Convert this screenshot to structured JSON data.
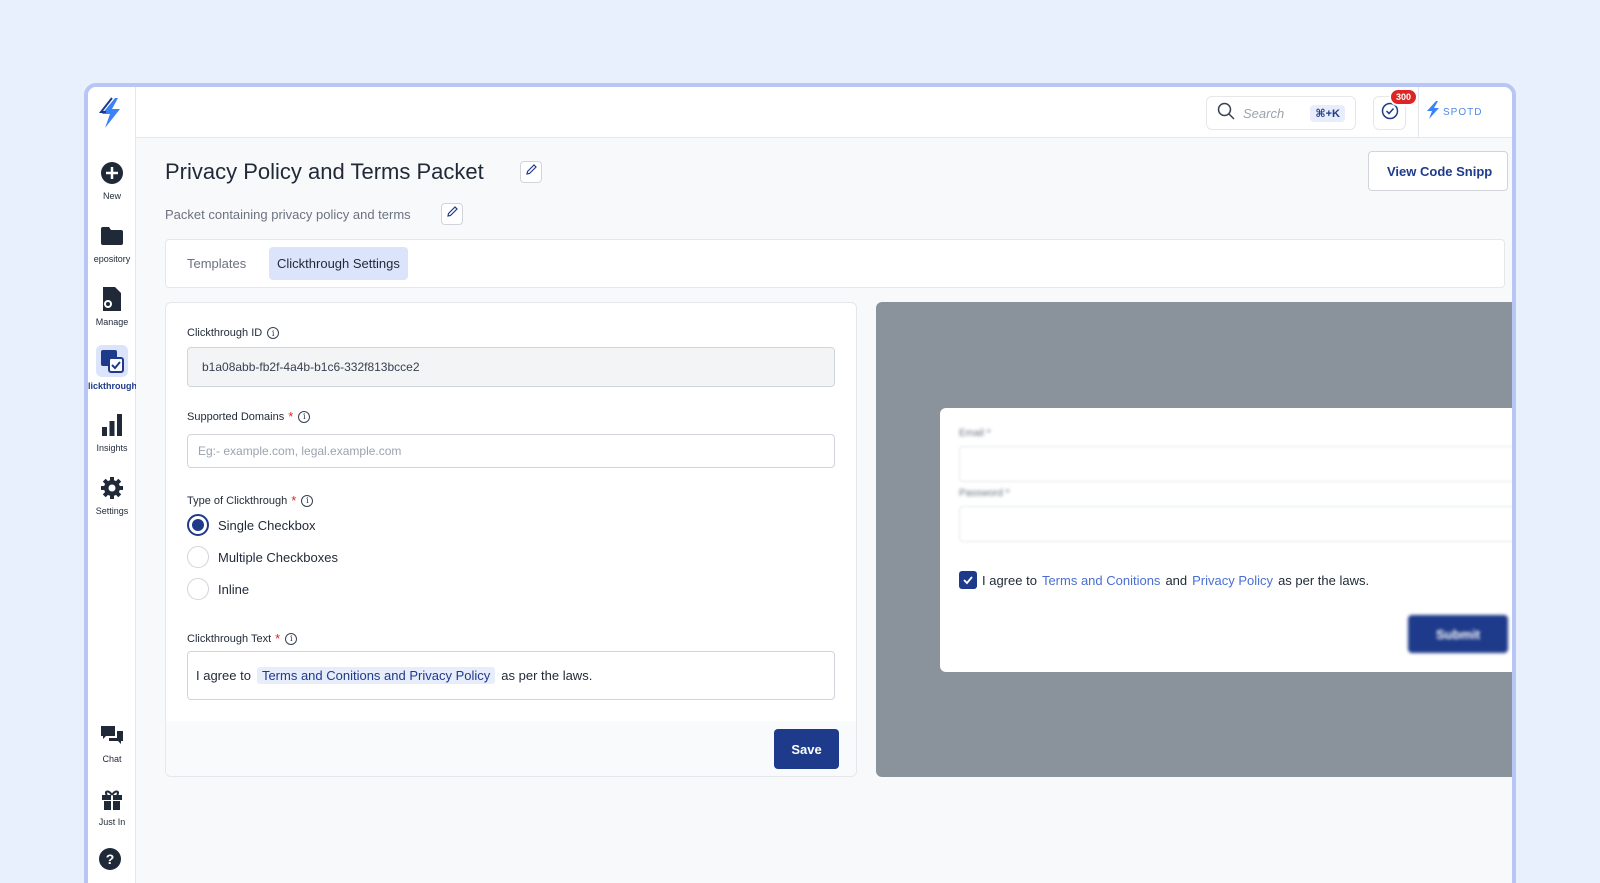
{
  "sidebar": {
    "items": [
      {
        "label": "New",
        "icon": "plus-circle-icon"
      },
      {
        "label": "epository",
        "icon": "folder-icon"
      },
      {
        "label": "Manage",
        "icon": "manage-document-icon"
      },
      {
        "label": "lickthrough",
        "icon": "clickthrough-icon",
        "active": true
      },
      {
        "label": "Insights",
        "icon": "bar-chart-icon"
      },
      {
        "label": "Settings",
        "icon": "gear-icon"
      }
    ],
    "bottom_items": [
      {
        "label": "Chat",
        "icon": "chat-icon"
      },
      {
        "label": "Just In",
        "icon": "gift-icon"
      },
      {
        "label": "",
        "icon": "help-icon"
      }
    ]
  },
  "topbar": {
    "search_placeholder": "Search",
    "search_shortcut": "⌘+K",
    "notification_count": "300",
    "brand": "SPOTD"
  },
  "header": {
    "title": "Privacy Policy and Terms Packet",
    "subtitle": "Packet containing privacy policy and terms",
    "view_code_label": "View Code Snipp"
  },
  "tabs": [
    {
      "label": "Templates"
    },
    {
      "label": "Clickthrough Settings",
      "active": true
    }
  ],
  "form": {
    "id_label": "Clickthrough ID",
    "id_value": "b1a08abb-fb2f-4a4b-b1c6-332f813bcce2",
    "domains_label": "Supported Domains",
    "domains_placeholder": "Eg:- example.com, legal.example.com",
    "type_label": "Type of Clickthrough",
    "type_options": [
      "Single Checkbox",
      "Multiple Checkboxes",
      "Inline"
    ],
    "type_selected": "Single Checkbox",
    "text_label": "Clickthrough Text",
    "text_prefix": "I agree to",
    "text_chip": "Terms and Conitions and Privacy Policy",
    "text_suffix": "as per the laws.",
    "save_label": "Save",
    "required_mark": "*",
    "info_glyph": "i"
  },
  "preview": {
    "email_label": "Email *",
    "password_label": "Password *",
    "agree_prefix": "I agree to",
    "link1": "Terms and Conitions",
    "agree_and": "and",
    "link2": "Privacy Policy",
    "agree_suffix": "as per the laws.",
    "submit_label": "Submit"
  },
  "colors": {
    "primary": "#1e3a8a",
    "accent_light": "#dce4fb",
    "danger": "#dc2626",
    "preview_bg": "#8a939c",
    "page_bg": "#e8effd",
    "brand_blue": "#4f8ae8"
  }
}
